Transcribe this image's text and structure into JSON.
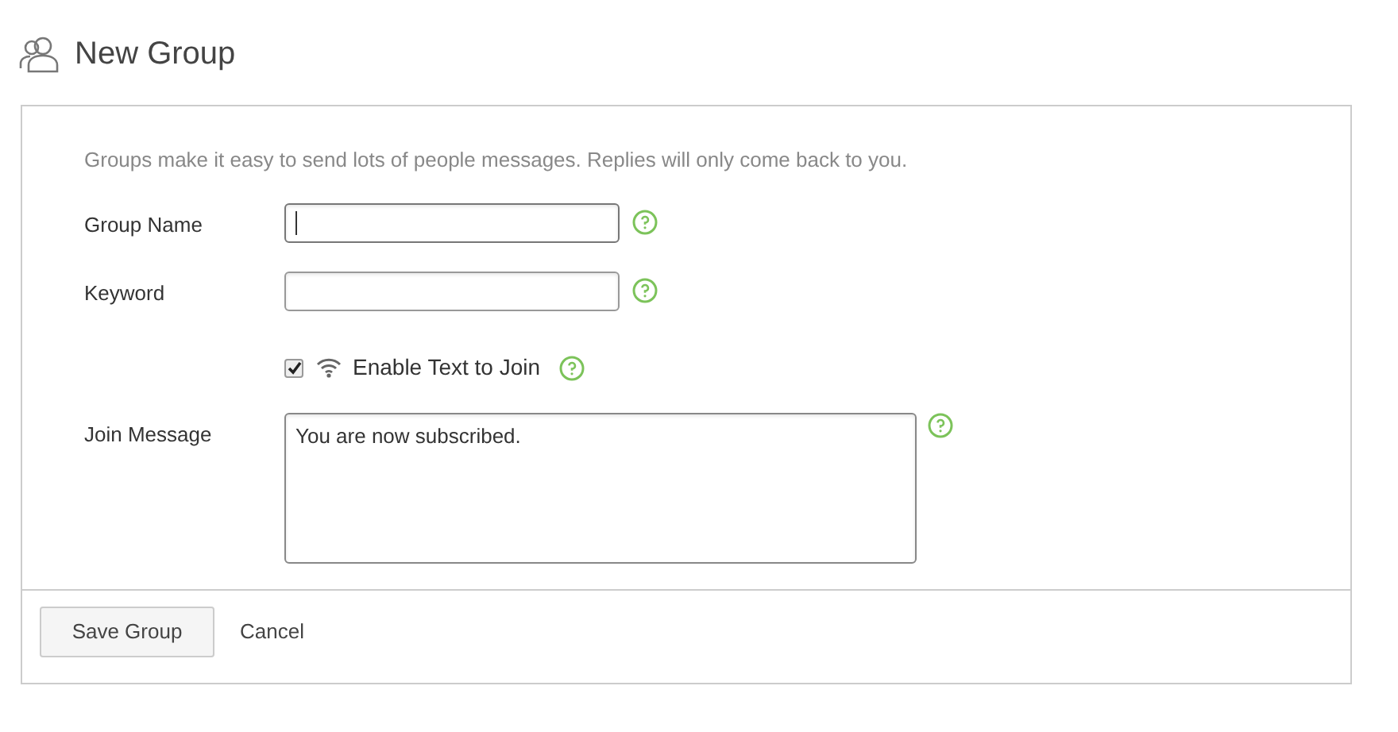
{
  "page": {
    "title": "New Group"
  },
  "form": {
    "intro": "Groups make it easy to send lots of people messages. Replies will only come back to you.",
    "fields": [
      {
        "kind": "input",
        "label": "Group Name",
        "focused": true
      },
      {
        "kind": "input",
        "label": "Keyword",
        "focused": false
      },
      {
        "kind": "checkbox",
        "label": "Enable Text to Join",
        "checked": true
      },
      {
        "kind": "textarea",
        "label": "Join Message",
        "value": "You are now subscribed.",
        "focused": false
      }
    ]
  },
  "buttons": [
    {
      "kind": "primary",
      "label": "Save Group"
    },
    {
      "kind": "link",
      "label": "Cancel"
    }
  ]
}
